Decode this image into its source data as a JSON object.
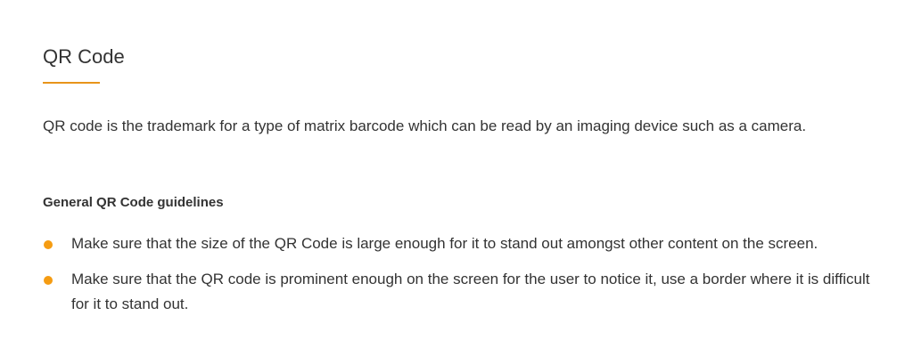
{
  "section": {
    "title": "QR Code",
    "intro": "QR code is the trademark for a type of matrix barcode which can be read by an imaging device such as a camera.",
    "subheading": "General QR Code guidelines",
    "guidelines": [
      "Make sure that the size of the QR Code is large enough for it to stand out amongst other content on the screen.",
      "Make sure that the QR code is prominent enough on the screen for the user to notice it, use a border where it is difficult for it to stand out."
    ]
  },
  "colors": {
    "accent": "#e8941a",
    "bullet": "#f59c12",
    "text": "#333333"
  }
}
